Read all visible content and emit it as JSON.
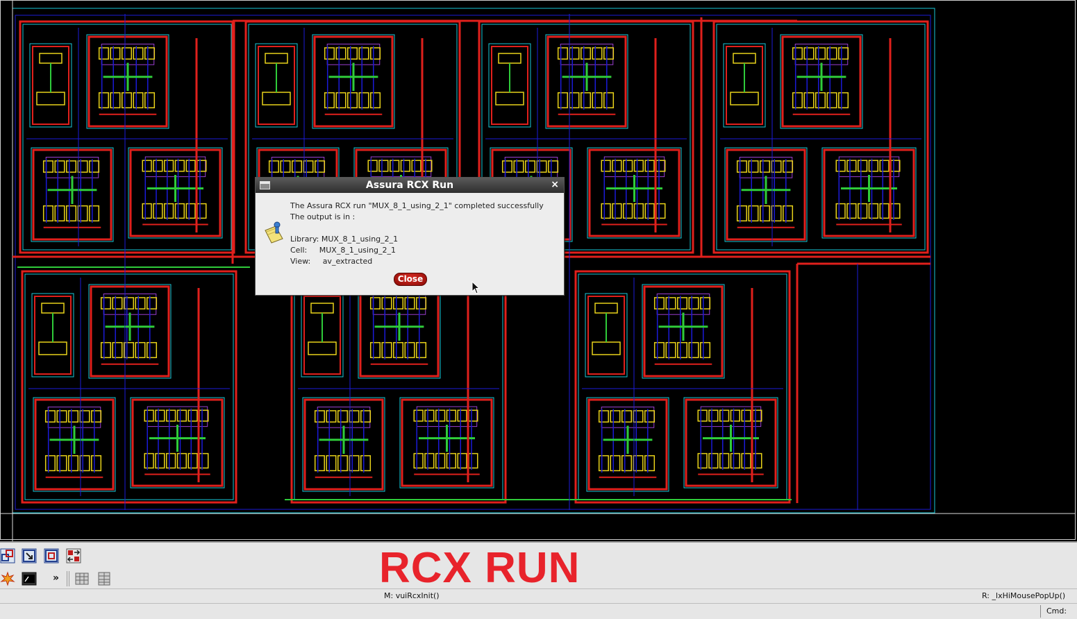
{
  "dialog": {
    "title": "Assura RCX Run",
    "message_line1": "The Assura RCX run \"MUX_8_1_using_2_1\" completed successfully",
    "message_line2": "The output is in :",
    "library_line": "Library: MUX_8_1_using_2_1",
    "cell_line": "Cell:     MUX_8_1_using_2_1",
    "view_line": "View:     av_extracted",
    "close_label": "Close"
  },
  "overlay": {
    "caption": "RCX RUN"
  },
  "toolbar": {
    "more_label": "»"
  },
  "status": {
    "mouse_left": "M: vuiRcxInit()",
    "mouse_right": "R: _lxHiMousePopUp()",
    "cmd_label": "Cmd:"
  },
  "colors": {
    "metal_red": "#e0201c",
    "boundary_blue": "#1b1bd8",
    "cell_cyan": "#18c9d8",
    "poly_green": "#2fcc3a",
    "diff_yellow": "#e8d21a",
    "nwell_purple": "#9a3fd0",
    "caption_red": "#e8232b"
  }
}
